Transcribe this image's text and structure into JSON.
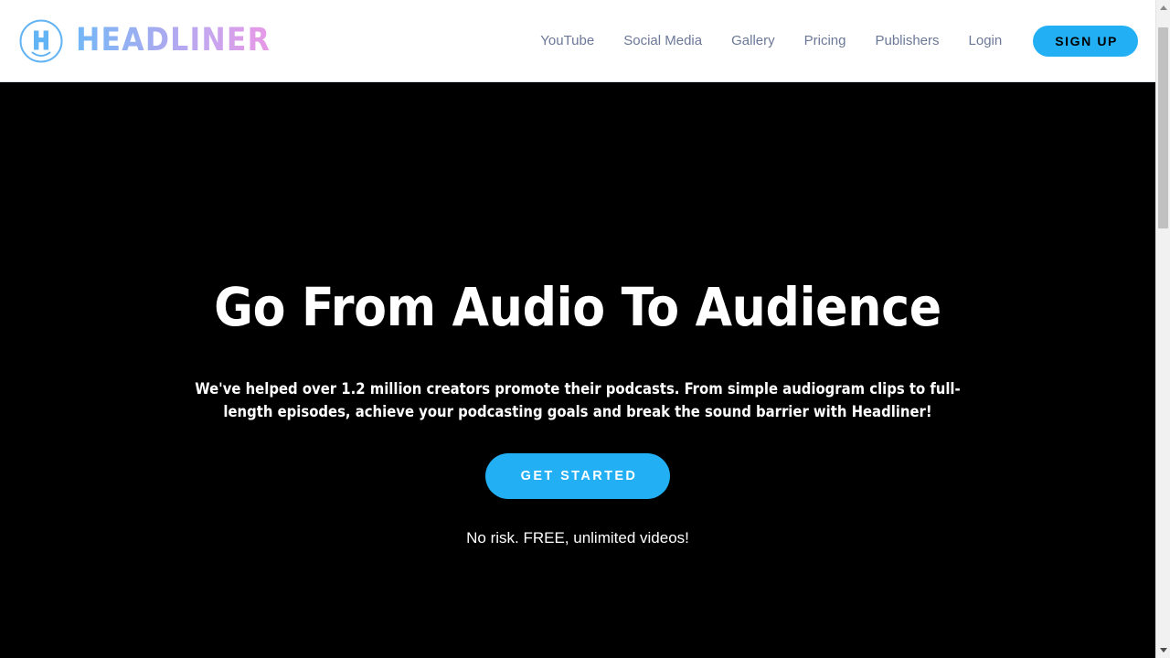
{
  "header": {
    "logo": {
      "icon_name": "headliner-smiley-h-icon",
      "wordmark": "HEADLINER"
    },
    "nav_links": [
      {
        "label": "YouTube"
      },
      {
        "label": "Social Media"
      },
      {
        "label": "Gallery"
      },
      {
        "label": "Pricing"
      },
      {
        "label": "Publishers"
      },
      {
        "label": "Login"
      }
    ],
    "signup_label": "SIGN UP"
  },
  "hero": {
    "title": "Go From Audio To Audience",
    "subtitle": "We've helped over 1.2 million creators promote their podcasts. From simple audiogram clips to full-length episodes, achieve your podcasting goals and break the sound barrier with Headliner!",
    "cta_label": "GET STARTED",
    "note": "No risk. FREE, unlimited videos!"
  },
  "colors": {
    "accent_blue": "#22aff4",
    "hero_background": "#000000",
    "header_background": "#ffffff",
    "nav_link": "#6b7897",
    "logo_gradient_start": "#72b6f7",
    "logo_gradient_end": "#e79ae6"
  },
  "scrollbar": {
    "up_arrow_name": "scroll-up-arrow",
    "down_arrow_name": "scroll-down-arrow"
  }
}
